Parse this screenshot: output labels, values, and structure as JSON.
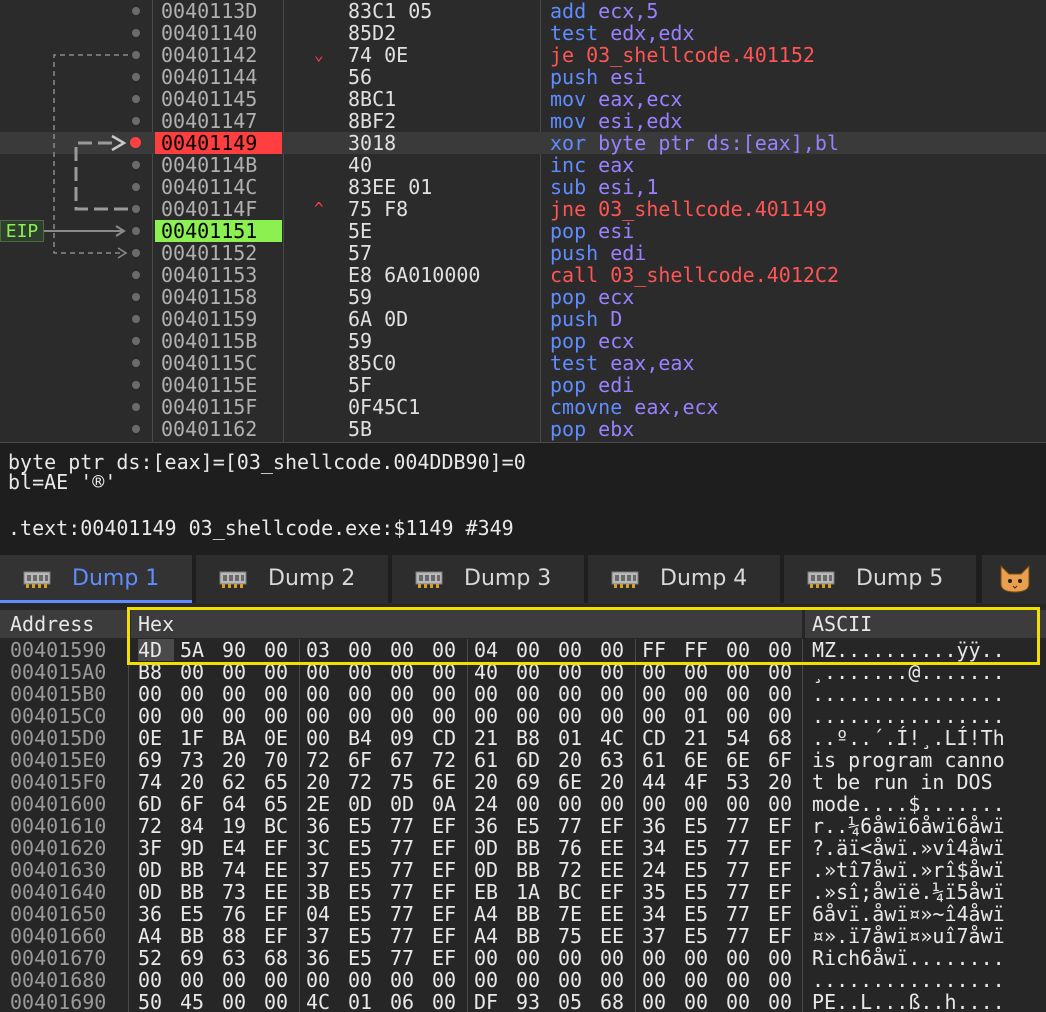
{
  "disasm": {
    "eip_label": "EIP",
    "rows": [
      {
        "addr": "0040113D",
        "bytes": "83C1 05",
        "mn": "add",
        "ops": "ecx,5",
        "kind": "arith",
        "jmark": ""
      },
      {
        "addr": "00401140",
        "bytes": "85D2",
        "mn": "test",
        "ops": "edx,edx",
        "kind": "arith",
        "jmark": ""
      },
      {
        "addr": "00401142",
        "bytes": "74 0E",
        "mn": "je",
        "ops": "03_shellcode.401152",
        "kind": "jump",
        "jmark": "⌄"
      },
      {
        "addr": "00401144",
        "bytes": "56",
        "mn": "push",
        "ops": "esi",
        "kind": "stack",
        "jmark": ""
      },
      {
        "addr": "00401145",
        "bytes": "8BC1",
        "mn": "mov",
        "ops": "eax,ecx",
        "kind": "mov",
        "jmark": ""
      },
      {
        "addr": "00401147",
        "bytes": "8BF2",
        "mn": "mov",
        "ops": "esi,edx",
        "kind": "mov",
        "jmark": ""
      },
      {
        "addr": "00401149",
        "bytes": "3018",
        "mn": "xor",
        "ops": "byte ptr ds:[eax],bl",
        "kind": "xor",
        "jmark": "",
        "bp": true,
        "selected": true
      },
      {
        "addr": "0040114B",
        "bytes": "40",
        "mn": "inc",
        "ops": "eax",
        "kind": "arith",
        "jmark": ""
      },
      {
        "addr": "0040114C",
        "bytes": "83EE 01",
        "mn": "sub",
        "ops": "esi,1",
        "kind": "arith",
        "jmark": ""
      },
      {
        "addr": "0040114F",
        "bytes": "75 F8",
        "mn": "jne",
        "ops": "03_shellcode.401149",
        "kind": "jump",
        "jmark": "^"
      },
      {
        "addr": "00401151",
        "bytes": "5E",
        "mn": "pop",
        "ops": "esi",
        "kind": "stack",
        "jmark": "",
        "eip": true
      },
      {
        "addr": "00401152",
        "bytes": "57",
        "mn": "push",
        "ops": "edi",
        "kind": "stack",
        "jmark": ""
      },
      {
        "addr": "00401153",
        "bytes": "E8 6A010000",
        "mn": "call",
        "ops": "03_shellcode.4012C2",
        "kind": "jump",
        "jmark": ""
      },
      {
        "addr": "00401158",
        "bytes": "59",
        "mn": "pop",
        "ops": "ecx",
        "kind": "stack",
        "jmark": ""
      },
      {
        "addr": "00401159",
        "bytes": "6A 0D",
        "mn": "push",
        "ops": "D",
        "kind": "stack",
        "jmark": ""
      },
      {
        "addr": "0040115B",
        "bytes": "59",
        "mn": "pop",
        "ops": "ecx",
        "kind": "stack",
        "jmark": ""
      },
      {
        "addr": "0040115C",
        "bytes": "85C0",
        "mn": "test",
        "ops": "eax,eax",
        "kind": "arith",
        "jmark": ""
      },
      {
        "addr": "0040115E",
        "bytes": "5F",
        "mn": "pop",
        "ops": "edi",
        "kind": "stack",
        "jmark": ""
      },
      {
        "addr": "0040115F",
        "bytes": "0F45C1",
        "mn": "cmovne",
        "ops": "eax,ecx",
        "kind": "mov",
        "jmark": ""
      },
      {
        "addr": "00401162",
        "bytes": "5B",
        "mn": "pop",
        "ops": "ebx",
        "kind": "stack",
        "jmark": ""
      }
    ]
  },
  "info": {
    "line1": "byte ptr ds:[eax]=[03_shellcode.004DDB90]=0",
    "line2": "bl=AE '®'",
    "line3": ".text:00401149 03_shellcode.exe:$1149 #349"
  },
  "tabs": [
    {
      "label": "Dump 1",
      "active": true
    },
    {
      "label": "Dump 2",
      "active": false
    },
    {
      "label": "Dump 3",
      "active": false
    },
    {
      "label": "Dump 4",
      "active": false
    },
    {
      "label": "Dump 5",
      "active": false
    }
  ],
  "dump": {
    "headers": {
      "address": "Address",
      "hex": "Hex",
      "ascii": "ASCII"
    },
    "rows": [
      {
        "addr": "00401590",
        "bytes": [
          "4D",
          "5A",
          "90",
          "00",
          "03",
          "00",
          "00",
          "00",
          "04",
          "00",
          "00",
          "00",
          "FF",
          "FF",
          "00",
          "00"
        ],
        "ascii": "MZ..........ÿÿ.."
      },
      {
        "addr": "004015A0",
        "bytes": [
          "B8",
          "00",
          "00",
          "00",
          "00",
          "00",
          "00",
          "00",
          "40",
          "00",
          "00",
          "00",
          "00",
          "00",
          "00",
          "00"
        ],
        "ascii": "¸.......@......."
      },
      {
        "addr": "004015B0",
        "bytes": [
          "00",
          "00",
          "00",
          "00",
          "00",
          "00",
          "00",
          "00",
          "00",
          "00",
          "00",
          "00",
          "00",
          "00",
          "00",
          "00"
        ],
        "ascii": "................"
      },
      {
        "addr": "004015C0",
        "bytes": [
          "00",
          "00",
          "00",
          "00",
          "00",
          "00",
          "00",
          "00",
          "00",
          "00",
          "00",
          "00",
          "00",
          "01",
          "00",
          "00"
        ],
        "ascii": "................"
      },
      {
        "addr": "004015D0",
        "bytes": [
          "0E",
          "1F",
          "BA",
          "0E",
          "00",
          "B4",
          "09",
          "CD",
          "21",
          "B8",
          "01",
          "4C",
          "CD",
          "21",
          "54",
          "68"
        ],
        "ascii": "..º..´.Í!¸.LÍ!Th"
      },
      {
        "addr": "004015E0",
        "bytes": [
          "69",
          "73",
          "20",
          "70",
          "72",
          "6F",
          "67",
          "72",
          "61",
          "6D",
          "20",
          "63",
          "61",
          "6E",
          "6E",
          "6F"
        ],
        "ascii": "is program canno"
      },
      {
        "addr": "004015F0",
        "bytes": [
          "74",
          "20",
          "62",
          "65",
          "20",
          "72",
          "75",
          "6E",
          "20",
          "69",
          "6E",
          "20",
          "44",
          "4F",
          "53",
          "20"
        ],
        "ascii": "t be run in DOS "
      },
      {
        "addr": "00401600",
        "bytes": [
          "6D",
          "6F",
          "64",
          "65",
          "2E",
          "0D",
          "0D",
          "0A",
          "24",
          "00",
          "00",
          "00",
          "00",
          "00",
          "00",
          "00"
        ],
        "ascii": "mode....$......."
      },
      {
        "addr": "00401610",
        "bytes": [
          "72",
          "84",
          "19",
          "BC",
          "36",
          "E5",
          "77",
          "EF",
          "36",
          "E5",
          "77",
          "EF",
          "36",
          "E5",
          "77",
          "EF"
        ],
        "ascii": "r..¼6åwï6åwï6åwï"
      },
      {
        "addr": "00401620",
        "bytes": [
          "3F",
          "9D",
          "E4",
          "EF",
          "3C",
          "E5",
          "77",
          "EF",
          "0D",
          "BB",
          "76",
          "EE",
          "34",
          "E5",
          "77",
          "EF"
        ],
        "ascii": "?.äï<åwï.»vî4åwï"
      },
      {
        "addr": "00401630",
        "bytes": [
          "0D",
          "BB",
          "74",
          "EE",
          "37",
          "E5",
          "77",
          "EF",
          "0D",
          "BB",
          "72",
          "EE",
          "24",
          "E5",
          "77",
          "EF"
        ],
        "ascii": ".»tî7åwï.»rî$åwï"
      },
      {
        "addr": "00401640",
        "bytes": [
          "0D",
          "BB",
          "73",
          "EE",
          "3B",
          "E5",
          "77",
          "EF",
          "EB",
          "1A",
          "BC",
          "EF",
          "35",
          "E5",
          "77",
          "EF"
        ],
        "ascii": ".»sî;åwïë.¼ï5åwï"
      },
      {
        "addr": "00401650",
        "bytes": [
          "36",
          "E5",
          "76",
          "EF",
          "04",
          "E5",
          "77",
          "EF",
          "A4",
          "BB",
          "7E",
          "EE",
          "34",
          "E5",
          "77",
          "EF"
        ],
        "ascii": "6åvï.åwï¤»~î4åwï"
      },
      {
        "addr": "00401660",
        "bytes": [
          "A4",
          "BB",
          "88",
          "EF",
          "37",
          "E5",
          "77",
          "EF",
          "A4",
          "BB",
          "75",
          "EE",
          "37",
          "E5",
          "77",
          "EF"
        ],
        "ascii": "¤».ï7åwï¤»uî7åwï"
      },
      {
        "addr": "00401670",
        "bytes": [
          "52",
          "69",
          "63",
          "68",
          "36",
          "E5",
          "77",
          "EF",
          "00",
          "00",
          "00",
          "00",
          "00",
          "00",
          "00",
          "00"
        ],
        "ascii": "Rich6åwï........"
      },
      {
        "addr": "00401680",
        "bytes": [
          "00",
          "00",
          "00",
          "00",
          "00",
          "00",
          "00",
          "00",
          "00",
          "00",
          "00",
          "00",
          "00",
          "00",
          "00",
          "00"
        ],
        "ascii": "................"
      },
      {
        "addr": "00401690",
        "bytes": [
          "50",
          "45",
          "00",
          "00",
          "4C",
          "01",
          "06",
          "00",
          "DF",
          "93",
          "05",
          "68",
          "00",
          "00",
          "00",
          "00"
        ],
        "ascii": "PE..L...ß..h...."
      }
    ]
  }
}
